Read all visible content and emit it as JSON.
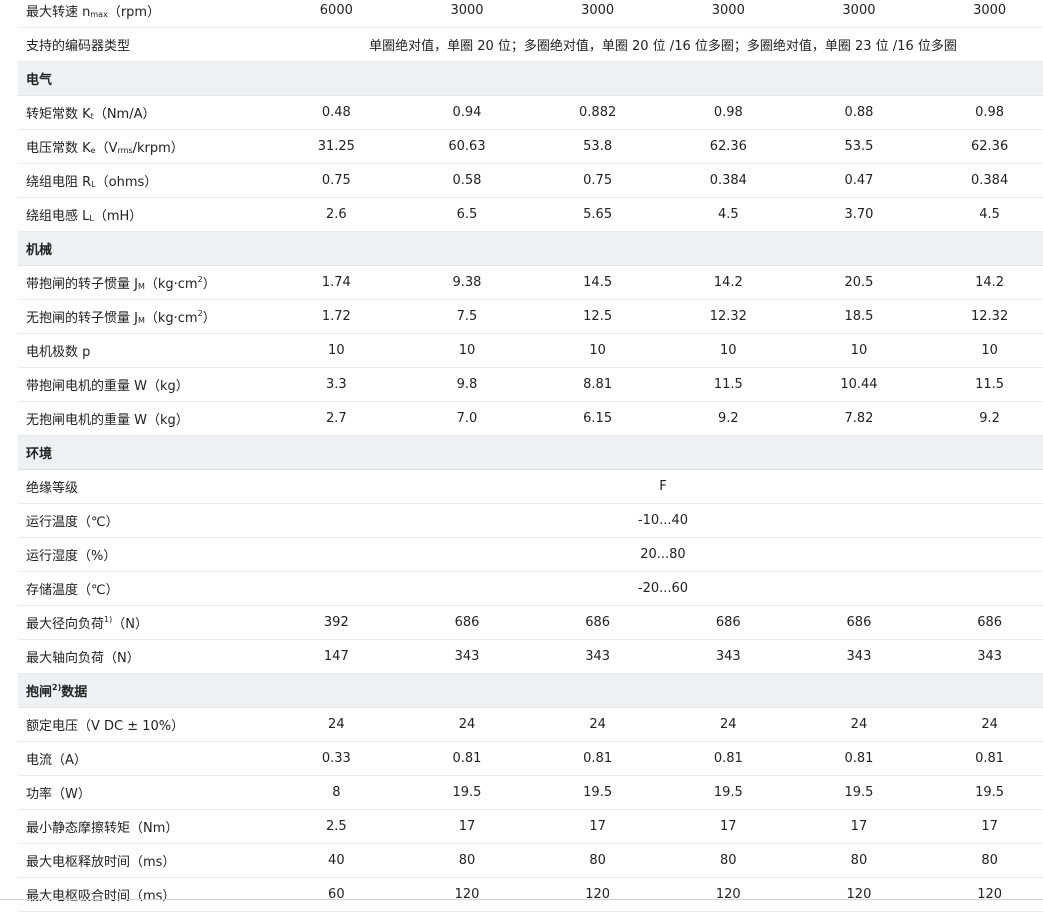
{
  "table": {
    "rows": [
      {
        "type": "data",
        "label_parts": [
          {
            "t": "最大转速 "
          },
          {
            "t": "n",
            "cls": ""
          },
          {
            "t": "max",
            "cls": "sub"
          },
          {
            "t": "（rpm）"
          }
        ],
        "values": [
          "6000",
          "3000",
          "3000",
          "3000",
          "3000",
          "3000"
        ]
      },
      {
        "type": "span",
        "label_parts": [
          {
            "t": "支持的编码器类型"
          }
        ],
        "span_value": "单圈绝对值，单圈 20 位；多圈绝对值，单圈 20 位 /16 位多圈；多圈绝对值，单圈 23 位 /16 位多圈"
      },
      {
        "type": "section",
        "label_parts": [
          {
            "t": "电气"
          }
        ]
      },
      {
        "type": "data",
        "label_parts": [
          {
            "t": "转矩常数 K"
          },
          {
            "t": "t",
            "cls": "sub"
          },
          {
            "t": "（Nm/A）"
          }
        ],
        "values": [
          "0.48",
          "0.94",
          "0.882",
          "0.98",
          "0.88",
          "0.98"
        ]
      },
      {
        "type": "data",
        "label_parts": [
          {
            "t": "电压常数 K"
          },
          {
            "t": "e",
            "cls": "sub"
          },
          {
            "t": "（V"
          },
          {
            "t": "rms",
            "cls": "sub"
          },
          {
            "t": "/krpm）"
          }
        ],
        "values": [
          "31.25",
          "60.63",
          "53.8",
          "62.36",
          "53.5",
          "62.36"
        ]
      },
      {
        "type": "data",
        "label_parts": [
          {
            "t": "绕组电阻 R"
          },
          {
            "t": "L",
            "cls": "sub"
          },
          {
            "t": "（ohms）"
          }
        ],
        "values": [
          "0.75",
          "0.58",
          "0.75",
          "0.384",
          "0.47",
          "0.384"
        ]
      },
      {
        "type": "data",
        "label_parts": [
          {
            "t": "绕组电感 L"
          },
          {
            "t": "L",
            "cls": "sub"
          },
          {
            "t": "（mH）"
          }
        ],
        "values": [
          "2.6",
          "6.5",
          "5.65",
          "4.5",
          "3.70",
          "4.5"
        ]
      },
      {
        "type": "section",
        "label_parts": [
          {
            "t": "机械"
          }
        ]
      },
      {
        "type": "data",
        "label_parts": [
          {
            "t": "带抱闸的转子惯量 J"
          },
          {
            "t": "M",
            "cls": "sub"
          },
          {
            "t": "（kg·cm"
          },
          {
            "t": "2",
            "cls": "sup"
          },
          {
            "t": "）"
          }
        ],
        "values": [
          "1.74",
          "9.38",
          "14.5",
          "14.2",
          "20.5",
          "14.2"
        ]
      },
      {
        "type": "data",
        "label_parts": [
          {
            "t": "无抱闸的转子惯量 J"
          },
          {
            "t": "M",
            "cls": "sub"
          },
          {
            "t": "（kg·cm"
          },
          {
            "t": "2",
            "cls": "sup"
          },
          {
            "t": "）"
          }
        ],
        "values": [
          "1.72",
          "7.5",
          "12.5",
          "12.32",
          "18.5",
          "12.32"
        ]
      },
      {
        "type": "data",
        "label_parts": [
          {
            "t": "电机极数 p"
          }
        ],
        "values": [
          "10",
          "10",
          "10",
          "10",
          "10",
          "10"
        ]
      },
      {
        "type": "data",
        "label_parts": [
          {
            "t": "带抱闸电机的重量 W（kg）"
          }
        ],
        "values": [
          "3.3",
          "9.8",
          "8.81",
          "11.5",
          "10.44",
          "11.5"
        ]
      },
      {
        "type": "data",
        "label_parts": [
          {
            "t": "无抱闸电机的重量 W（kg）"
          }
        ],
        "values": [
          "2.7",
          "7.0",
          "6.15",
          "9.2",
          "7.82",
          "9.2"
        ]
      },
      {
        "type": "section",
        "label_parts": [
          {
            "t": "环境"
          }
        ]
      },
      {
        "type": "span",
        "label_parts": [
          {
            "t": "绝缘等级"
          }
        ],
        "span_value": "F"
      },
      {
        "type": "span",
        "label_parts": [
          {
            "t": "运行温度（℃）"
          }
        ],
        "span_value": "-10...40"
      },
      {
        "type": "span",
        "label_parts": [
          {
            "t": "运行湿度（%）"
          }
        ],
        "span_value": "20...80"
      },
      {
        "type": "span",
        "label_parts": [
          {
            "t": "存储温度（℃）"
          }
        ],
        "span_value": "-20...60"
      },
      {
        "type": "data",
        "label_parts": [
          {
            "t": "最大径向负荷"
          },
          {
            "t": "1)",
            "cls": "sup"
          },
          {
            "t": "（N）"
          }
        ],
        "values": [
          "392",
          "686",
          "686",
          "686",
          "686",
          "686"
        ]
      },
      {
        "type": "data",
        "label_parts": [
          {
            "t": "最大轴向负荷（N）"
          }
        ],
        "values": [
          "147",
          "343",
          "343",
          "343",
          "343",
          "343"
        ]
      },
      {
        "type": "section",
        "label_parts": [
          {
            "t": "抱闸"
          },
          {
            "t": "2)",
            "cls": "sup"
          },
          {
            "t": "数据"
          }
        ]
      },
      {
        "type": "data",
        "label_parts": [
          {
            "t": "额定电压（V DC ± 10%）"
          }
        ],
        "values": [
          "24",
          "24",
          "24",
          "24",
          "24",
          "24"
        ]
      },
      {
        "type": "data",
        "label_parts": [
          {
            "t": "电流（A）"
          }
        ],
        "values": [
          "0.33",
          "0.81",
          "0.81",
          "0.81",
          "0.81",
          "0.81"
        ]
      },
      {
        "type": "data",
        "label_parts": [
          {
            "t": "功率（W）"
          }
        ],
        "values": [
          "8",
          "19.5",
          "19.5",
          "19.5",
          "19.5",
          "19.5"
        ]
      },
      {
        "type": "data",
        "label_parts": [
          {
            "t": "最小静态摩擦转矩（Nm）"
          }
        ],
        "values": [
          "2.5",
          "17",
          "17",
          "17",
          "17",
          "17"
        ]
      },
      {
        "type": "data",
        "label_parts": [
          {
            "t": "最大电枢释放时间（ms）"
          }
        ],
        "values": [
          "40",
          "80",
          "80",
          "80",
          "80",
          "80"
        ]
      },
      {
        "type": "data",
        "label_parts": [
          {
            "t": "最大电枢吸合时间（ms）"
          }
        ],
        "values": [
          "60",
          "120",
          "120",
          "120",
          "120",
          "120"
        ]
      }
    ]
  }
}
